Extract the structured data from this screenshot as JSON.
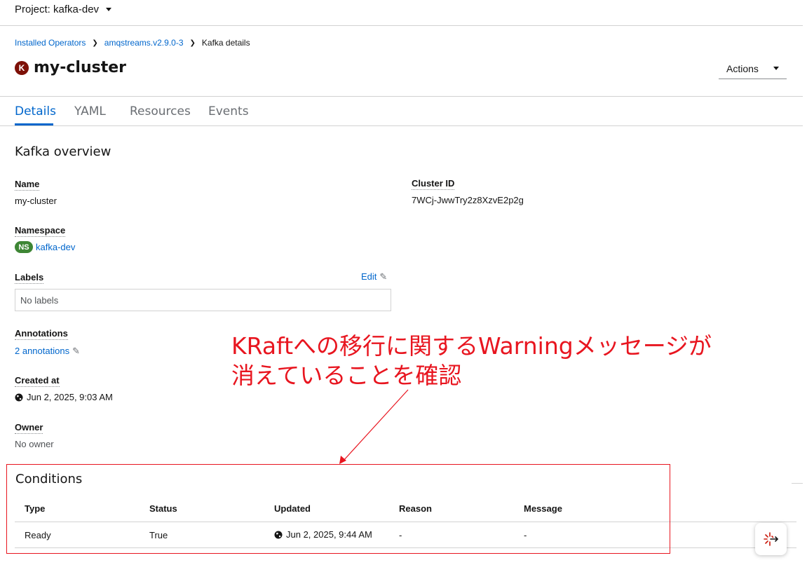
{
  "project": {
    "label": "Project: kafka-dev"
  },
  "breadcrumb": {
    "items": [
      "Installed Operators",
      "amqstreams.v2.9.0-3",
      "Kafka details"
    ]
  },
  "title": {
    "badge": "K",
    "name": "my-cluster"
  },
  "actions": {
    "label": "Actions"
  },
  "tabs": [
    "Details",
    "YAML",
    "Resources",
    "Events"
  ],
  "overview": {
    "heading": "Kafka overview",
    "name_label": "Name",
    "name_value": "my-cluster",
    "cluster_id_label": "Cluster ID",
    "cluster_id_value": "7WCj-JwwTry2z8XzvE2p2g",
    "namespace_label": "Namespace",
    "namespace_badge": "NS",
    "namespace_value": "kafka-dev",
    "labels_label": "Labels",
    "labels_edit": "Edit",
    "labels_value": "No labels",
    "annotations_label": "Annotations",
    "annotations_value": "2 annotations",
    "created_label": "Created at",
    "created_value": "Jun 2, 2025, 9:03 AM",
    "owner_label": "Owner",
    "owner_value": "No owner"
  },
  "annotation": {
    "line1": "KRaftへの移行に関するWarningメッセージが",
    "line2": "消えていることを確認",
    "color": "#e8151f"
  },
  "conditions": {
    "heading": "Conditions",
    "columns": [
      "Type",
      "Status",
      "Updated",
      "Reason",
      "Message"
    ],
    "rows": [
      {
        "type": "Ready",
        "status": "True",
        "updated": "Jun 2, 2025, 9:44 AM",
        "reason": "-",
        "message": "-"
      }
    ]
  },
  "colors": {
    "link": "#0066cc",
    "accent_red": "#e8151f",
    "k_badge": "#7d1007",
    "ns_badge": "#3e8635"
  }
}
